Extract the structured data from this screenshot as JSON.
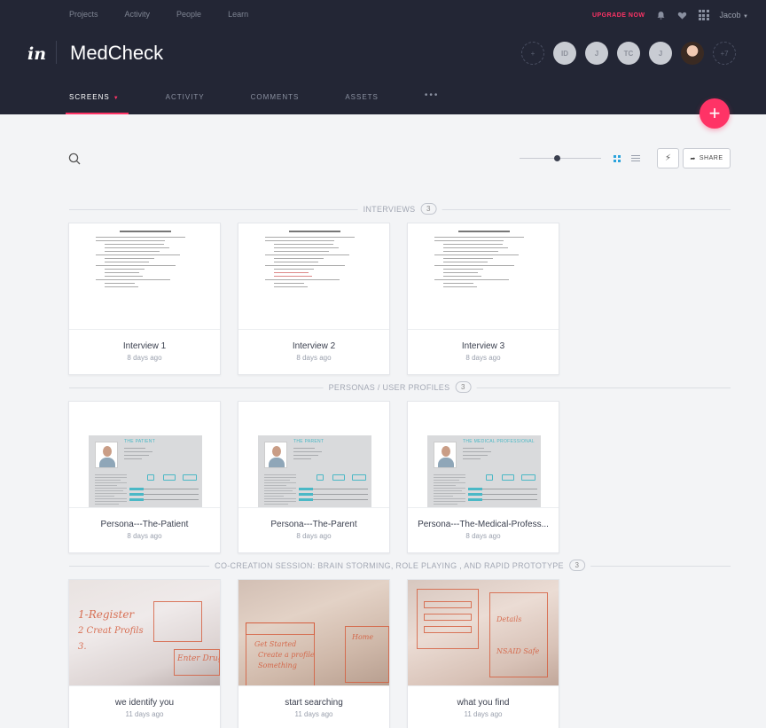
{
  "topnav": [
    "Projects",
    "Activity",
    "People",
    "Learn"
  ],
  "topright": {
    "upgrade": "UPGRADE NOW",
    "user": "Jacob"
  },
  "project": {
    "logo": "in",
    "title": "MedCheck"
  },
  "collaborators": {
    "add": "+",
    "initials": [
      "ID",
      "J",
      "TC",
      "J"
    ],
    "more": "+7"
  },
  "tabs": {
    "screens": "SCREENS",
    "activity": "ACTIVITY",
    "comments": "COMMENTS",
    "assets": "ASSETS",
    "more": "•••"
  },
  "fab": "+",
  "toolbar": {
    "share": "SHARE"
  },
  "sections": [
    {
      "title": "INTERVIEWS",
      "count": "3",
      "cards": [
        {
          "name": "Interview 1",
          "date": "8 days ago"
        },
        {
          "name": "Interview 2",
          "date": "8 days ago"
        },
        {
          "name": "Interview 3",
          "date": "8 days ago"
        }
      ]
    },
    {
      "title": "PERSONAS / USER PROFILES",
      "count": "3",
      "cards": [
        {
          "name": "Persona---The-Patient",
          "date": "8 days ago",
          "thumb_title": "THE PATIENT"
        },
        {
          "name": "Persona---The-Parent",
          "date": "8 days ago",
          "thumb_title": "THE PARENT"
        },
        {
          "name": "Persona---The-Medical-Profess...",
          "date": "8 days ago",
          "thumb_title": "THE MEDICAL PROFESSIONAL"
        }
      ]
    },
    {
      "title": "CO-CREATION SESSION: BRAIN STORMING, ROLE PLAYING , AND RAPID PROTOTYPE",
      "count": "3",
      "cards": [
        {
          "name": "we identify you",
          "date": "11 days ago"
        },
        {
          "name": "start searching",
          "date": "11 days ago"
        },
        {
          "name": "what you find",
          "date": "11 days ago"
        }
      ]
    }
  ],
  "colors": {
    "header": "#232635",
    "accent": "#ff3366",
    "persona_accent": "#4ab8c6"
  },
  "icons": [
    "search-icon",
    "bell-icon",
    "heart-icon",
    "apps-grid-icon",
    "bolt-icon",
    "share-arrow-icon",
    "grid-view-icon",
    "list-view-icon"
  ]
}
